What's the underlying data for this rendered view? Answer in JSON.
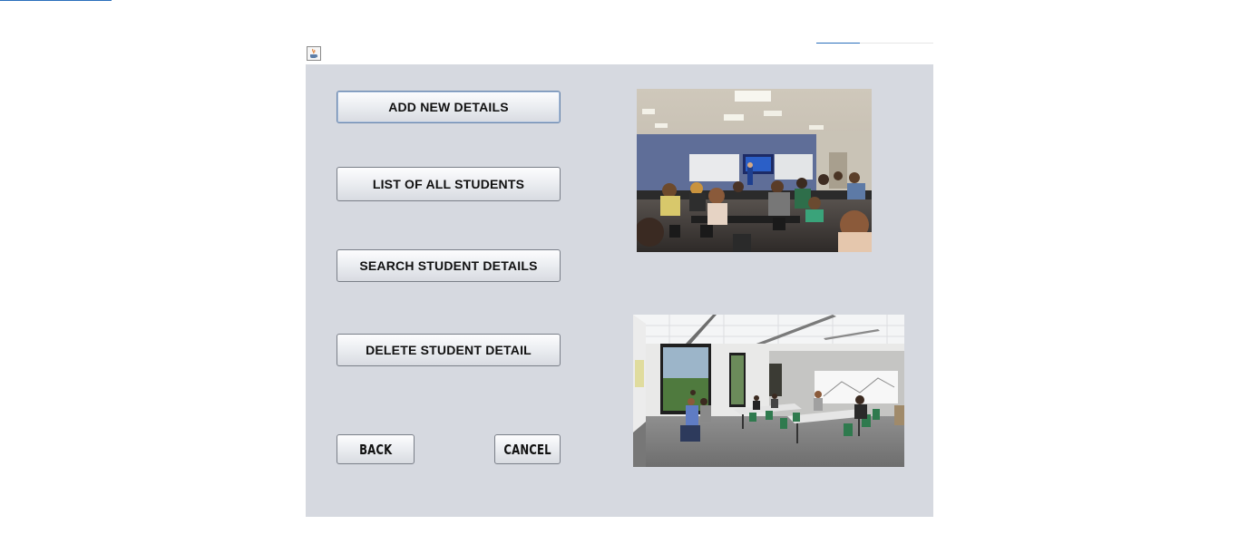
{
  "window": {
    "icon": "java-app-icon"
  },
  "menu": {
    "add_new_details": "ADD NEW DETAILS",
    "list_all_students": "LIST OF ALL STUDENTS",
    "search_student_details": "SEARCH STUDENT DETAILS",
    "delete_student_detail": "DELETE STUDENT DETAIL"
  },
  "footer": {
    "back": "BACK",
    "cancel": "CANCEL"
  },
  "images": {
    "top": "classroom-lecture-photo",
    "bottom": "modern-classroom-photo"
  },
  "colors": {
    "panel_background": "#d6d9e0",
    "focus_border": "#6b87ad"
  }
}
